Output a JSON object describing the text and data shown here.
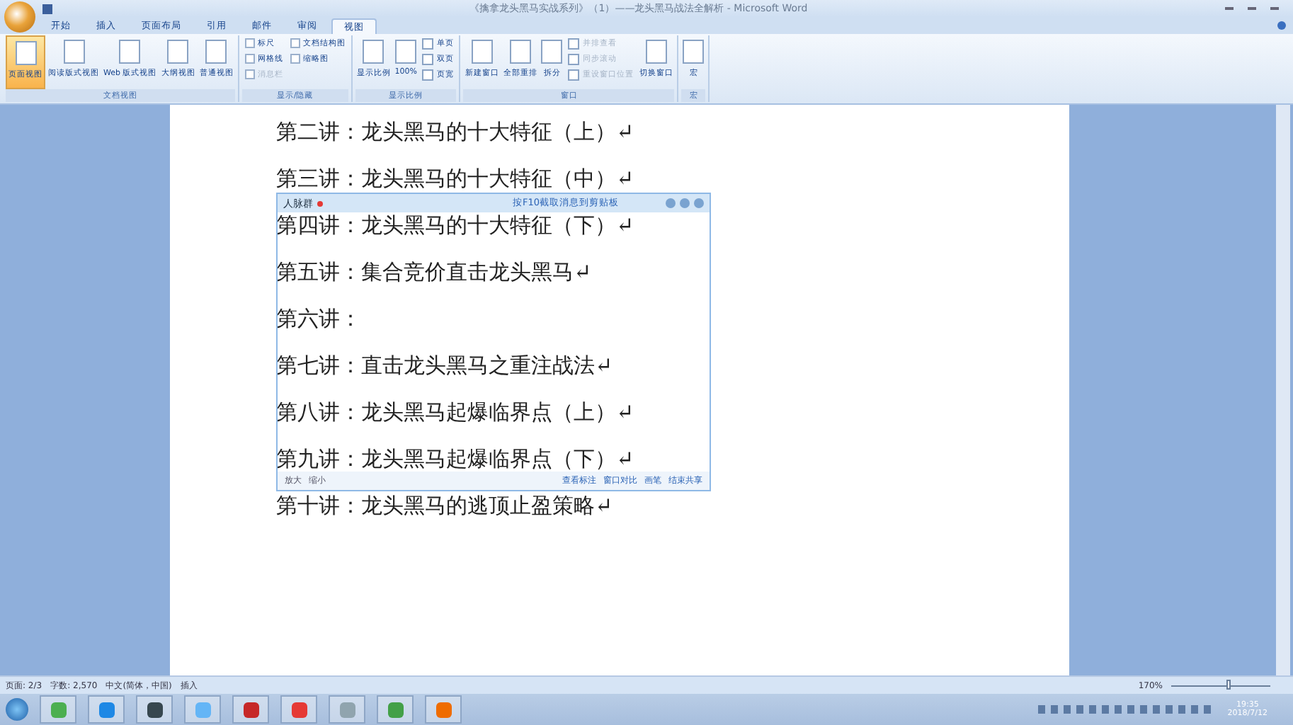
{
  "window": {
    "title": "《擒拿龙头黑马实战系列》（1）——龙头黑马战法全解析 - Microsoft Word"
  },
  "tabs": [
    {
      "label": "开始",
      "selected": false
    },
    {
      "label": "插入",
      "selected": false
    },
    {
      "label": "页面布局",
      "selected": false
    },
    {
      "label": "引用",
      "selected": false
    },
    {
      "label": "邮件",
      "selected": false
    },
    {
      "label": "审阅",
      "selected": false
    },
    {
      "label": "视图",
      "selected": true
    }
  ],
  "ribbon": {
    "groups": [
      {
        "title": "文档视图",
        "items": [
          {
            "kind": "big",
            "label": "页面视图",
            "selected": true
          },
          {
            "kind": "big",
            "label": "阅读版式视图",
            "selected": false
          },
          {
            "kind": "big",
            "label": "Web 版式视图",
            "selected": false
          },
          {
            "kind": "big",
            "label": "大纲视图",
            "selected": false
          },
          {
            "kind": "big",
            "label": "普通视图",
            "selected": false
          }
        ]
      },
      {
        "title": "显示/隐藏",
        "items": [
          {
            "kind": "check",
            "label": "标尺",
            "checked": false
          },
          {
            "kind": "check",
            "label": "网格线",
            "checked": false
          },
          {
            "kind": "check",
            "label": "消息栏",
            "checked": false,
            "disabled": true
          },
          {
            "kind": "check",
            "label": "文档结构图",
            "checked": false
          },
          {
            "kind": "check",
            "label": "缩略图",
            "checked": false
          }
        ]
      },
      {
        "title": "显示比例",
        "items": [
          {
            "kind": "big",
            "label": "显示比例",
            "selected": false
          },
          {
            "kind": "big",
            "label": "100%",
            "selected": false
          },
          {
            "kind": "small",
            "label": "单页"
          },
          {
            "kind": "small",
            "label": "双页"
          },
          {
            "kind": "small",
            "label": "页宽"
          }
        ]
      },
      {
        "title": "窗口",
        "items": [
          {
            "kind": "big",
            "label": "新建窗口",
            "selected": false
          },
          {
            "kind": "big",
            "label": "全部重排",
            "selected": false
          },
          {
            "kind": "big",
            "label": "拆分",
            "selected": false
          },
          {
            "kind": "small",
            "label": "并排查看",
            "disabled": true
          },
          {
            "kind": "small",
            "label": "同步滚动",
            "disabled": true
          },
          {
            "kind": "small",
            "label": "重设窗口位置",
            "disabled": true
          },
          {
            "kind": "big",
            "label": "切换窗口",
            "selected": false
          }
        ]
      },
      {
        "title": "宏",
        "items": [
          {
            "kind": "big",
            "label": "宏",
            "selected": false
          }
        ]
      }
    ]
  },
  "document": {
    "lines": [
      "第二讲：龙头黑马的十大特征（上）↵",
      "第三讲：龙头黑马的十大特征（中）↵",
      "第四讲：龙头黑马的十大特征（下）↵",
      "第五讲：集合竞价直击龙头黑马↵",
      "第六讲：",
      "第七讲：直击龙头黑马之重注战法↵",
      "第八讲：龙头黑马起爆临界点（上）↵",
      "第九讲：龙头黑马起爆临界点（下）↵",
      "第十讲：龙头黑马的逃顶止盈策略↵"
    ]
  },
  "share_window": {
    "title": "人脉群",
    "notice": "按F10截取消息到剪贴板",
    "tools_left": [
      "放大",
      "缩小"
    ],
    "tools_right": [
      "查看标注",
      "窗口对比",
      "画笔",
      "结束共享"
    ]
  },
  "status_bar": {
    "items": [
      "页面: 2/3",
      "字数: 2,570",
      "中文(简体，中国)",
      "插入"
    ],
    "zoom": "170%",
    "zoom_slider": {
      "level": 0.55
    }
  },
  "taskbar": {
    "time": "19:35",
    "date": "2018/7/12"
  }
}
